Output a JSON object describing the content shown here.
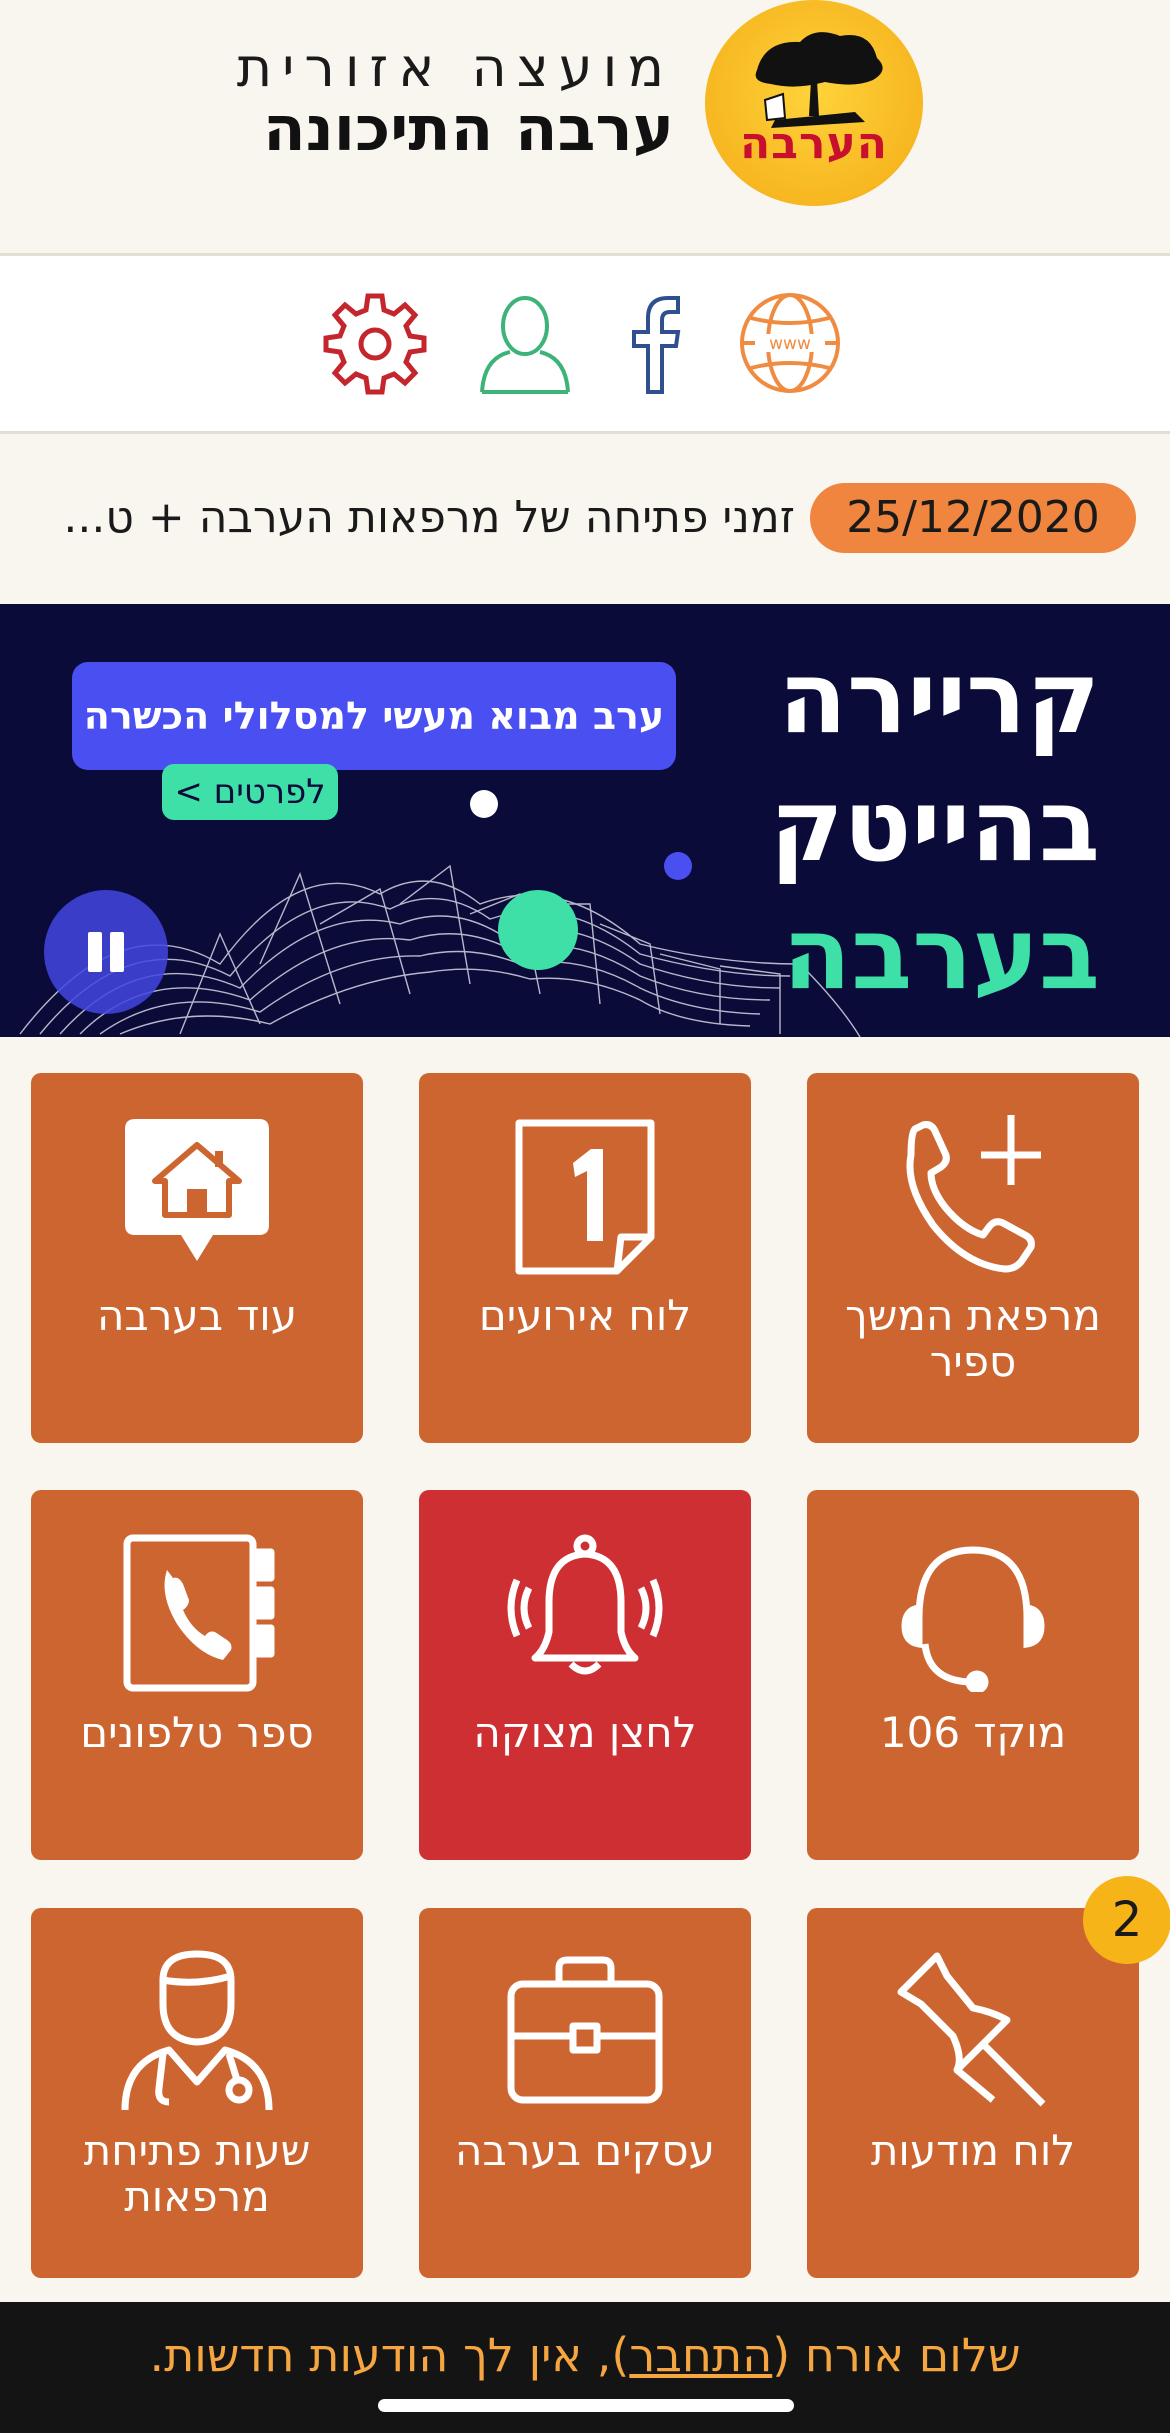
{
  "header": {
    "title_sub": "מועצה אזורית",
    "title_main": "ערבה התיכונה",
    "logo_text": "הערבה"
  },
  "icon_bar": [
    {
      "icon": "globe-icon",
      "color": "#f08c42"
    },
    {
      "icon": "facebook-icon",
      "color": "#2f4f8f"
    },
    {
      "icon": "user-icon",
      "color": "#3db37a"
    },
    {
      "icon": "gear-icon",
      "color": "#c4262e"
    }
  ],
  "news": {
    "date": "25/12/2020",
    "text": "זמני פתיחה של מרפאות הערבה + ט..."
  },
  "banner": {
    "line1": "קריירה",
    "line2": "בהייטק",
    "line3": "בערבה",
    "pill": "ערב מבוא מעשי למסלולי הכשרה",
    "details": "לפרטים >",
    "colors": {
      "background": "#0b0b3a",
      "accent": "#3ee0a8",
      "pill": "#4a4ff2"
    }
  },
  "tiles": [
    {
      "label": "מרפאת המשך ספיר",
      "icon": "phone-plus-icon"
    },
    {
      "label": "לוח אירועים",
      "icon": "calendar-one-icon"
    },
    {
      "label": "עוד בערבה",
      "icon": "house-bubble-icon"
    },
    {
      "label": "מוקד 106",
      "icon": "headset-icon"
    },
    {
      "label": "לחצן מצוקה",
      "icon": "alarm-bell-icon"
    },
    {
      "label": "ספר טלפונים",
      "icon": "phonebook-icon"
    },
    {
      "label": "לוח מודעות",
      "icon": "pushpin-icon"
    },
    {
      "label": "עסקים בערבה",
      "icon": "briefcase-icon"
    },
    {
      "label": "שעות פתיחת מרפאות",
      "icon": "doctor-icon"
    }
  ],
  "badge": "2",
  "footer": {
    "greeting": "שלום אורח (",
    "login": "התחבר",
    "rest": "), אין לך הודעות חדשות."
  },
  "colors": {
    "tile": "#cd6531",
    "tile_alert": "#ce2f33",
    "footer_text": "#f6a640",
    "page": "#f9f5ef"
  }
}
